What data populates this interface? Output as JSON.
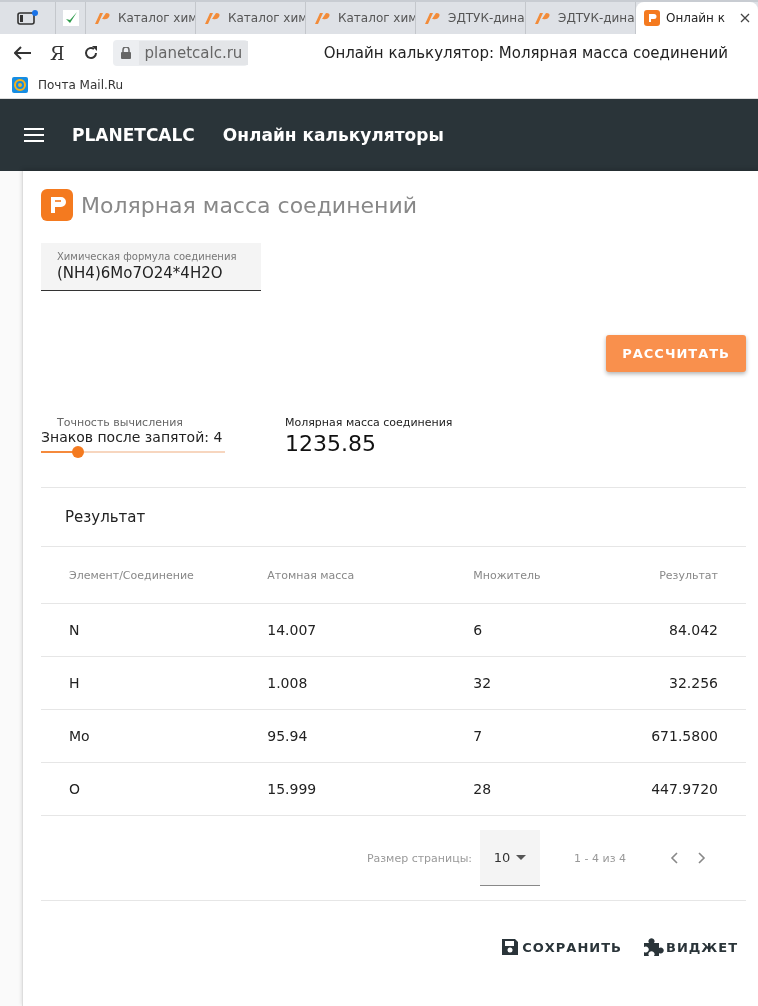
{
  "browser": {
    "tabs": [
      {
        "kind": "sidebar",
        "selected": false
      },
      {
        "kind": "check",
        "selected": false
      },
      {
        "kind": "ap",
        "title": "Каталог хим",
        "selected": false
      },
      {
        "kind": "ap",
        "title": "Каталог хим",
        "selected": false
      },
      {
        "kind": "ap",
        "title": "Каталог хим",
        "selected": false
      },
      {
        "kind": "ap",
        "title": "ЭДТУК-дина",
        "selected": false
      },
      {
        "kind": "ap",
        "title": "ЭДТУК-дина",
        "selected": false
      },
      {
        "kind": "pc",
        "title": "Онлайн к",
        "selected": true
      }
    ],
    "yandex_button": "Я",
    "url": "planetcalc.ru",
    "page_title": "Онлайн калькулятор: Молярная масса соединений",
    "bookmarks": [
      {
        "label": "Почта Mail.Ru"
      }
    ]
  },
  "header": {
    "brand": "PLANETCALC",
    "title": "Онлайн калькуляторы"
  },
  "calculator": {
    "title": "Молярная масса соединений",
    "formula_field": {
      "label": "Химическая формула соединения",
      "value": "(NH4)6Mo7O24*4H2O"
    },
    "calculate_button": "РАССЧИТАТЬ",
    "precision": {
      "label": "Точность вычисления",
      "value_text": "Знаков после запятой: 4",
      "level": 0.2
    },
    "result": {
      "label": "Молярная масса соединения",
      "value": "1235.85"
    },
    "table": {
      "title": "Результат",
      "columns": [
        "Элемент/Соединение",
        "Атомная масса",
        "Множитель",
        "Результат"
      ],
      "rows": [
        [
          "N",
          "14.007",
          "6",
          "84.042"
        ],
        [
          "H",
          "1.008",
          "32",
          "32.256"
        ],
        [
          "Mo",
          "95.94",
          "7",
          "671.5800"
        ],
        [
          "O",
          "15.999",
          "28",
          "447.9720"
        ]
      ]
    },
    "pagination": {
      "page_size_label": "Размер страницы:",
      "page_size": "10",
      "range": "1 - 4 из 4"
    },
    "actions": [
      {
        "kind": "save",
        "label": "СОХРАНИТЬ"
      },
      {
        "kind": "widget",
        "label": "ВИДЖЕТ"
      }
    ]
  }
}
